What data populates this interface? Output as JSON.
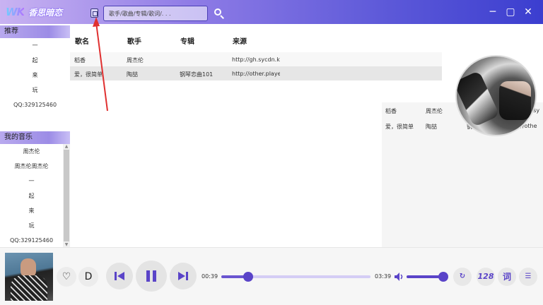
{
  "app": {
    "logo_mark": "WK",
    "logo_text": "香思暗恋"
  },
  "search": {
    "placeholder": "歌手/歌曲/专辑/歌词/. . ."
  },
  "sidebar": {
    "recommend_header": "推荐",
    "recommend_items": [
      "一",
      "起",
      "来",
      "玩",
      "QQ:329125460"
    ],
    "my_music_header": "我的音乐",
    "my_music_items": [
      "周杰伦",
      "周杰伦周杰伦",
      "一",
      "起",
      "来",
      "玩",
      "QQ:329125460"
    ]
  },
  "table": {
    "columns": [
      "歌名",
      "歌手",
      "专辑",
      "来源"
    ],
    "rows": [
      {
        "name": "稻香",
        "artist": "周杰伦",
        "album": "",
        "source": "http://gh.sycdn.ku"
      },
      {
        "name": "爱，很简单",
        "artist": "陶喆",
        "album": "钢琴恋曲101",
        "source": "http://other.playe"
      }
    ]
  },
  "overlay": {
    "rows": [
      {
        "name": "稻香",
        "artist": "周杰伦",
        "album": "",
        "source": "http://gh.sy"
      },
      {
        "name": "爱，很简单",
        "artist": "陶喆",
        "album": "钢琴恋曲101",
        "source": "http://othe"
      }
    ]
  },
  "player": {
    "current_time": "00:39",
    "total_time": "03:39",
    "progress": 0.18,
    "volume": 1.0,
    "quality_label": "128",
    "lyric_label": "词",
    "download_label": "D"
  },
  "colors": {
    "accent": "#5a44c8",
    "annotation": "#e03030"
  }
}
